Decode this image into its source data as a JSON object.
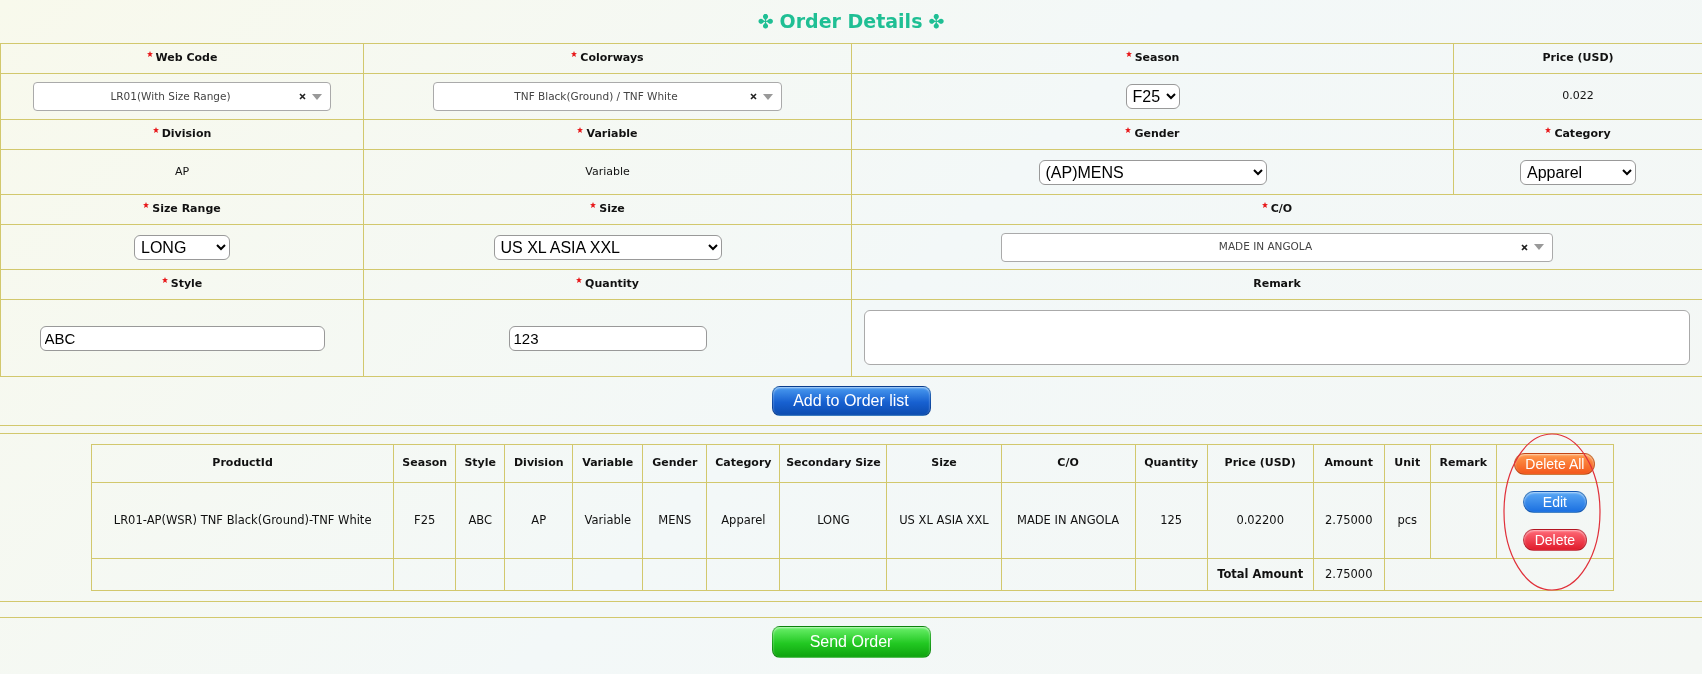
{
  "title": {
    "text": "Order Details",
    "ornaments": [
      "✤",
      "✤"
    ]
  },
  "form": {
    "rows": [
      [
        {
          "label": "Web Code",
          "required": true,
          "field": {
            "kind": "combo",
            "value": "LR01(With Size Range)"
          }
        },
        {
          "label": "Colorways",
          "required": true,
          "field": {
            "kind": "combo",
            "value": "TNF Black(Ground) / TNF White"
          }
        },
        {
          "label": "Season",
          "required": true,
          "field": {
            "kind": "select",
            "value": "F25"
          }
        },
        {
          "label": "Price (USD)",
          "required": false,
          "field": {
            "kind": "text",
            "value": "0.022"
          }
        }
      ],
      [
        {
          "label": "Division",
          "required": true,
          "field": {
            "kind": "text",
            "value": "AP"
          }
        },
        {
          "label": "Variable",
          "required": true,
          "field": {
            "kind": "text",
            "value": "Variable"
          }
        },
        {
          "label": "Gender",
          "required": true,
          "field": {
            "kind": "select",
            "value": "(AP)MENS"
          }
        },
        {
          "label": "Category",
          "required": true,
          "field": {
            "kind": "select",
            "value": "Apparel"
          }
        }
      ],
      [
        {
          "label": "Size Range",
          "required": true,
          "field": {
            "kind": "select",
            "value": "LONG"
          }
        },
        {
          "label": "Size",
          "required": true,
          "field": {
            "kind": "select",
            "value": "US XL ASIA XXL"
          }
        },
        {
          "label": "C/O",
          "required": true,
          "colspan": 2,
          "field": {
            "kind": "combo",
            "value": "MADE IN ANGOLA"
          }
        }
      ],
      [
        {
          "label": "Style",
          "required": true,
          "field": {
            "kind": "input",
            "value": "ABC"
          }
        },
        {
          "label": "Quantity",
          "required": true,
          "field": {
            "kind": "input",
            "value": "123"
          }
        },
        {
          "label": "Remark",
          "required": false,
          "colspan": 2,
          "field": {
            "kind": "textarea"
          }
        }
      ]
    ]
  },
  "add_button": "Add to Order list",
  "order_table": {
    "columns": [
      "ProductId",
      "Season",
      "Style",
      "Division",
      "Variable",
      "Gender",
      "Category",
      "Secondary Size",
      "Size",
      "C/O",
      "Quantity",
      "Price (USD)",
      "Amount",
      "Unit",
      "Remark"
    ],
    "delete_all_button": "Delete All",
    "rows": [
      {
        "cells": [
          "LR01-AP(WSR) TNF Black(Ground)-TNF White",
          "F25",
          "ABC",
          "AP",
          "Variable",
          "MENS",
          "Apparel",
          "LONG",
          "US XL ASIA XXL",
          "MADE IN ANGOLA",
          "125",
          "0.02200",
          "2.75000",
          "pcs"
        ],
        "edit_button": "Edit",
        "delete_button": "Delete"
      }
    ],
    "total_label": "Total Amount",
    "total_value": "2.75000"
  },
  "send_button": "Send Order"
}
